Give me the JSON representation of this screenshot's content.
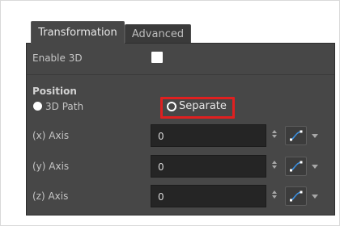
{
  "tabs": [
    {
      "label": "Transformation",
      "active": true
    },
    {
      "label": "Advanced",
      "active": false
    }
  ],
  "enable_3d": {
    "label": "Enable 3D",
    "checked": true
  },
  "position": {
    "heading": "Position",
    "mode_options": [
      {
        "label": "3D Path",
        "selected": true
      },
      {
        "label": "Separate",
        "selected": false
      }
    ]
  },
  "axes": [
    {
      "label": "(x) Axis",
      "value": "0",
      "function_icon": "function-curve-icon"
    },
    {
      "label": "(y) Axis",
      "value": "0",
      "function_icon": "function-curve-icon"
    },
    {
      "label": "(z) Axis",
      "value": "0",
      "function_icon": "function-curve-icon"
    }
  ],
  "colors": {
    "panel_bg": "#474747",
    "field_bg": "#252525",
    "highlight": "#e02020",
    "function_icon_blue": "#3b8fe0"
  }
}
